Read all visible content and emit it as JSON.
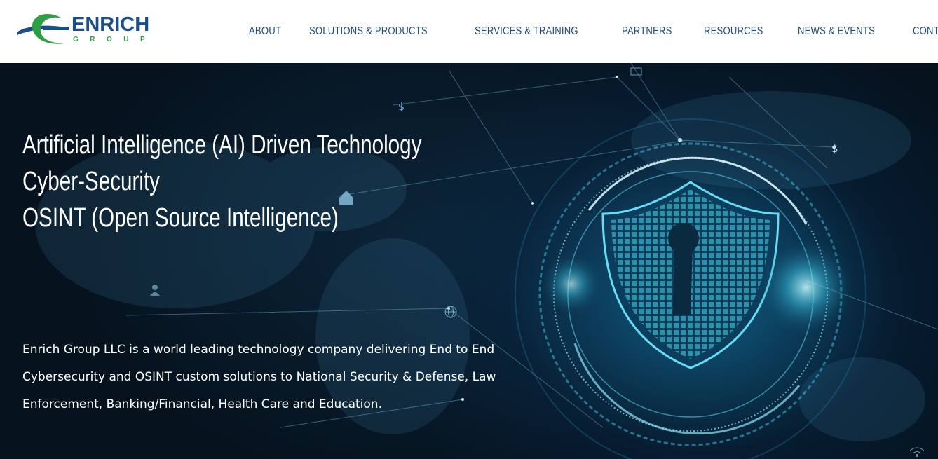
{
  "brand": {
    "name": "ENRICH",
    "subtitle": "GROUP",
    "colors": {
      "blue": "#1a4f8c",
      "green": "#2e9e46"
    }
  },
  "nav": {
    "items": [
      {
        "label": "ABOUT"
      },
      {
        "label": "SOLUTIONS & PRODUCTS"
      },
      {
        "label": "SERVICES & TRAINING"
      },
      {
        "label": "PARTNERS"
      },
      {
        "label": "RESOURCES"
      },
      {
        "label": "NEWS & EVENTS"
      },
      {
        "label": "CONTACT US"
      }
    ]
  },
  "hero": {
    "headlines": [
      "Artificial Intelligence (AI) Driven Technology",
      "Cyber-Security",
      "OSINT (Open Source Intelligence)"
    ],
    "description": "Enrich Group LLC is a world leading technology company delivering End to End Cybersecurity and OSINT custom solutions to National Security & Defense, Law Enforcement, Banking/Financial, Health Care and Education.",
    "icons": [
      "dollar-icon",
      "home-icon",
      "user-icon",
      "globe-icon",
      "shield-lock-icon",
      "monitor-icon",
      "wifi-icon"
    ]
  }
}
